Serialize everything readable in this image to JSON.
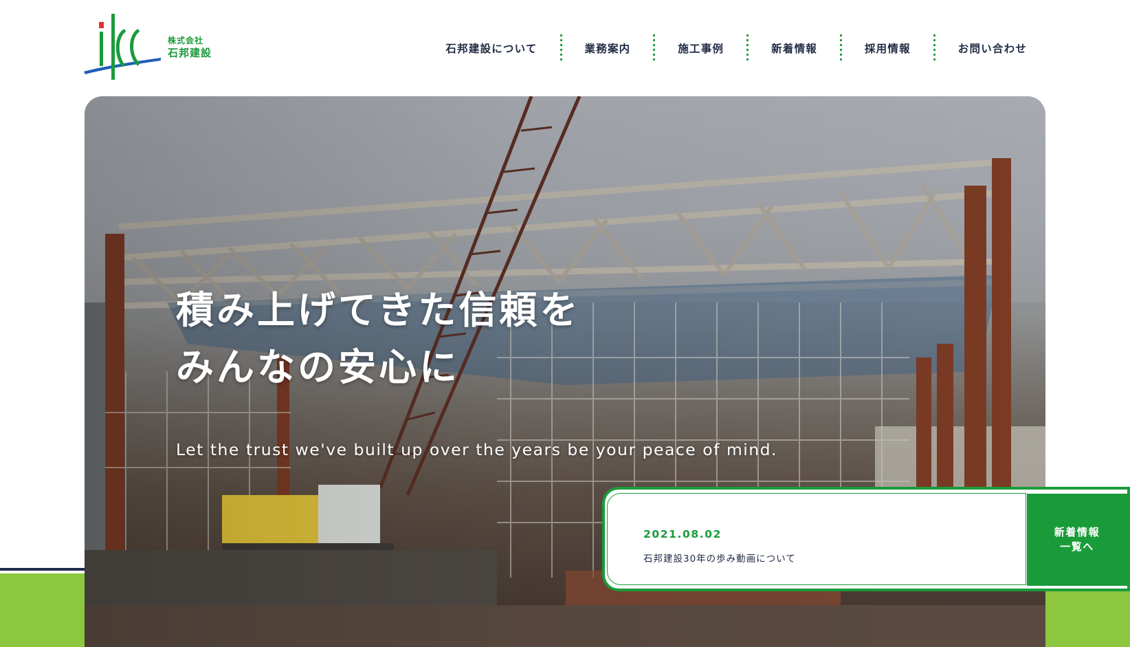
{
  "brand": {
    "logo_mark": "ikc",
    "company_type": "株式会社",
    "company_name": "石邦建設",
    "color_green": "#1a9b3a",
    "color_navy": "#1e2b4d",
    "color_lime": "#8dc63f"
  },
  "nav": {
    "items": [
      {
        "label": "石邦建設について"
      },
      {
        "label": "業務案内"
      },
      {
        "label": "施工事例"
      },
      {
        "label": "新着情報"
      },
      {
        "label": "採用情報"
      },
      {
        "label": "お問い合わせ"
      }
    ]
  },
  "hero": {
    "catch_line1": "積み上げてきた信頼を",
    "catch_line2": "みんなの安心に",
    "catch_en": "Let the trust we've built up over the years be your peace of mind.",
    "image_subject": "construction-site-steel-frame-crane"
  },
  "news": {
    "date": "2021.08.02",
    "title": "石邦建設30年の歩み動画について",
    "list_button": "新着情報\n一覧へ"
  }
}
